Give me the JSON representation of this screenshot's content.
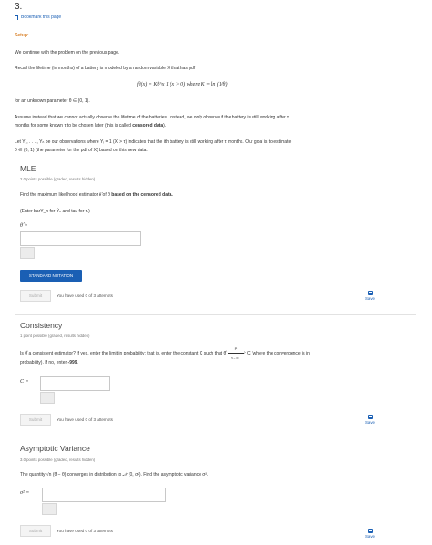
{
  "problem": {
    "number": "3.",
    "bookmark_label": "Bookmark this page"
  },
  "setup": {
    "heading": "Setup:",
    "p1": "We continue with the problem on the previous page.",
    "p2": "Recall the lifetime (in months) of a battery is modeled by a random variable X that has pdf",
    "formula": "fθ(x) = Kθ^x 1 (x > 0)      where  K = ln (1/θ)",
    "p3": "for an unknown parameter θ ∈ (0, 1).",
    "p4_line1": "Assume instead that we cannot actually observe the lifetime of the batteries. Instead, we only observe if the battery is still working after τ",
    "p4_line2a": "months for some known τ to be chosen later (this is called ",
    "p4_line2b": "censored data",
    "p4_line2c": ").",
    "p5_line1": "Let Y₁, . . . , Yₙ be our observations where Yᵢ = 1 (Xᵢ > τ) indicates that the ith battery is still working after τ months. Our goal is to estimate",
    "p5_line2": "θ ∈ (0, 1) (the parameter for the pdf of X) based on this new data."
  },
  "mle": {
    "title": "MLE",
    "points": "2.0 points possible (graded, results hidden)",
    "question_a": "Find the maximum likelihood estimator ",
    "question_sym": "θ̂",
    "question_b": " of θ ",
    "question_bold": "based on the censored data.",
    "hint": "(Enter barY_n for Ȳₙ and tau for τ.)",
    "input_label": "θ̂ =",
    "input_value": "",
    "standard_notation": "STANDARD NOTATION",
    "submit": "Submit",
    "attempts": "You have used 0 of 3 attempts",
    "save": "Save"
  },
  "consistency": {
    "title": "Consistency",
    "points": "1 point possible (graded, results hidden)",
    "q_line1a": "Is θ̂ a consistent estimator? If yes, enter the limit in probability; that is, enter the constant C such that θ̂ ",
    "arrow_top": "P",
    "arrow_bottom": "n→∞",
    "q_line1b": " C (where the convergence is in",
    "q_line2a": "probability). If no, enter ",
    "q_line2b": "-999",
    "q_line2c": ".",
    "input_label": "C =",
    "input_value": "",
    "submit": "Submit",
    "attempts": "You have used 0 of 3 attempts",
    "save": "Save"
  },
  "asymptotic": {
    "title": "Asymptotic Variance",
    "points": "3.0 points possible (graded, results hidden)",
    "question": "The quantity √n (θ̂ − θ) converges in distribution to 𝒩 (0, σ²). Find the asymptotic variance σ².",
    "input_label": "σ² =",
    "input_value": "",
    "submit": "Submit",
    "attempts": "You have used 0 of 3 attempts",
    "save": "Save"
  },
  "colors": {
    "accent": "#1a5fb4",
    "setup_orange": "#d9822b"
  }
}
